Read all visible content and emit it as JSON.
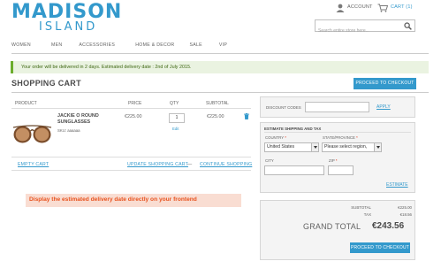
{
  "header": {
    "logo_main": "MADISON",
    "logo_sub": "ISLAND",
    "account_label": "ACCOUNT",
    "cart_label": "CART (1)",
    "search_placeholder": "Search entire store here..."
  },
  "nav": {
    "items": [
      "WOMEN",
      "MEN",
      "ACCESSORIES",
      "HOME & DECOR",
      "SALE",
      "VIP"
    ]
  },
  "notice": "Your order will be delivered in 2 days. Estimated delivery date : 2nd of July 2015.",
  "cart": {
    "title": "SHOPPING CART",
    "checkout_label": "PROCEED TO CHECKOUT",
    "columns": [
      "PRODUCT",
      "PRICE",
      "QTY",
      "SUBTOTAL"
    ],
    "item": {
      "name": "JACKIE O ROUND SUNGLASSES",
      "sku": "SKU: aaaaaa",
      "price": "€225.00",
      "qty": "1",
      "edit_label": "Edit",
      "subtotal": "€225.00"
    },
    "empty_label": "EMPTY CART",
    "update_label": "UPDATE SHOPPING CART",
    "separator": "—",
    "continue_label": "CONTINUE SHOPPING"
  },
  "promo": "Display the estimated delivery date directly on your frontend",
  "discount": {
    "label": "DISCOUNT CODES",
    "apply_label": "APPLY"
  },
  "shipping": {
    "title": "ESTIMATE SHIPPING AND TAX",
    "country_label": "COUNTRY",
    "country_value": "United States",
    "state_label": "STATE/PROVINCE",
    "state_value": "Please select region,",
    "city_label": "CITY",
    "zip_label": "ZIP",
    "required_mark": "*",
    "estimate_label": "ESTIMATE"
  },
  "totals": {
    "subtotal_label": "SUBTOTAL",
    "subtotal_value": "€225.00",
    "tax_label": "TAX",
    "tax_value": "€18.56",
    "grand_label": "GRAND TOTAL",
    "grand_value": "€243.56",
    "checkout_label": "PROCEED TO CHECKOUT"
  },
  "colors": {
    "brand_blue": "#3399cc",
    "notice_green": "#6cad2d",
    "promo_orange": "#e8531f"
  }
}
